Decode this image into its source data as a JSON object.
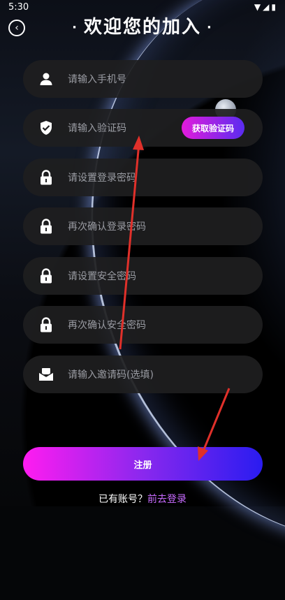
{
  "status_bar": {
    "time": "5:30",
    "icons": [
      "wifi-icon",
      "signal-icon",
      "battery-icon"
    ]
  },
  "header": {
    "title": "欢迎您的加入",
    "decoration": "·"
  },
  "form": {
    "phone_placeholder": "请输入手机号",
    "code_placeholder": "请输入验证码",
    "get_code_label": "获取验证码",
    "login_password_placeholder": "请设置登录密码",
    "confirm_login_password_placeholder": "再次确认登录密码",
    "security_password_placeholder": "请设置安全密码",
    "confirm_security_password_placeholder": "再次确认安全密码",
    "invite_code_placeholder": "请输入邀请码(选填)"
  },
  "actions": {
    "register_label": "注册"
  },
  "footer": {
    "prompt": "已有账号？",
    "login_link": "前去登录"
  },
  "colors": {
    "accent_start": "#ff1cf0",
    "accent_end": "#2a1cf0",
    "link": "#c86bff",
    "annotation_arrow": "#e0302a"
  }
}
